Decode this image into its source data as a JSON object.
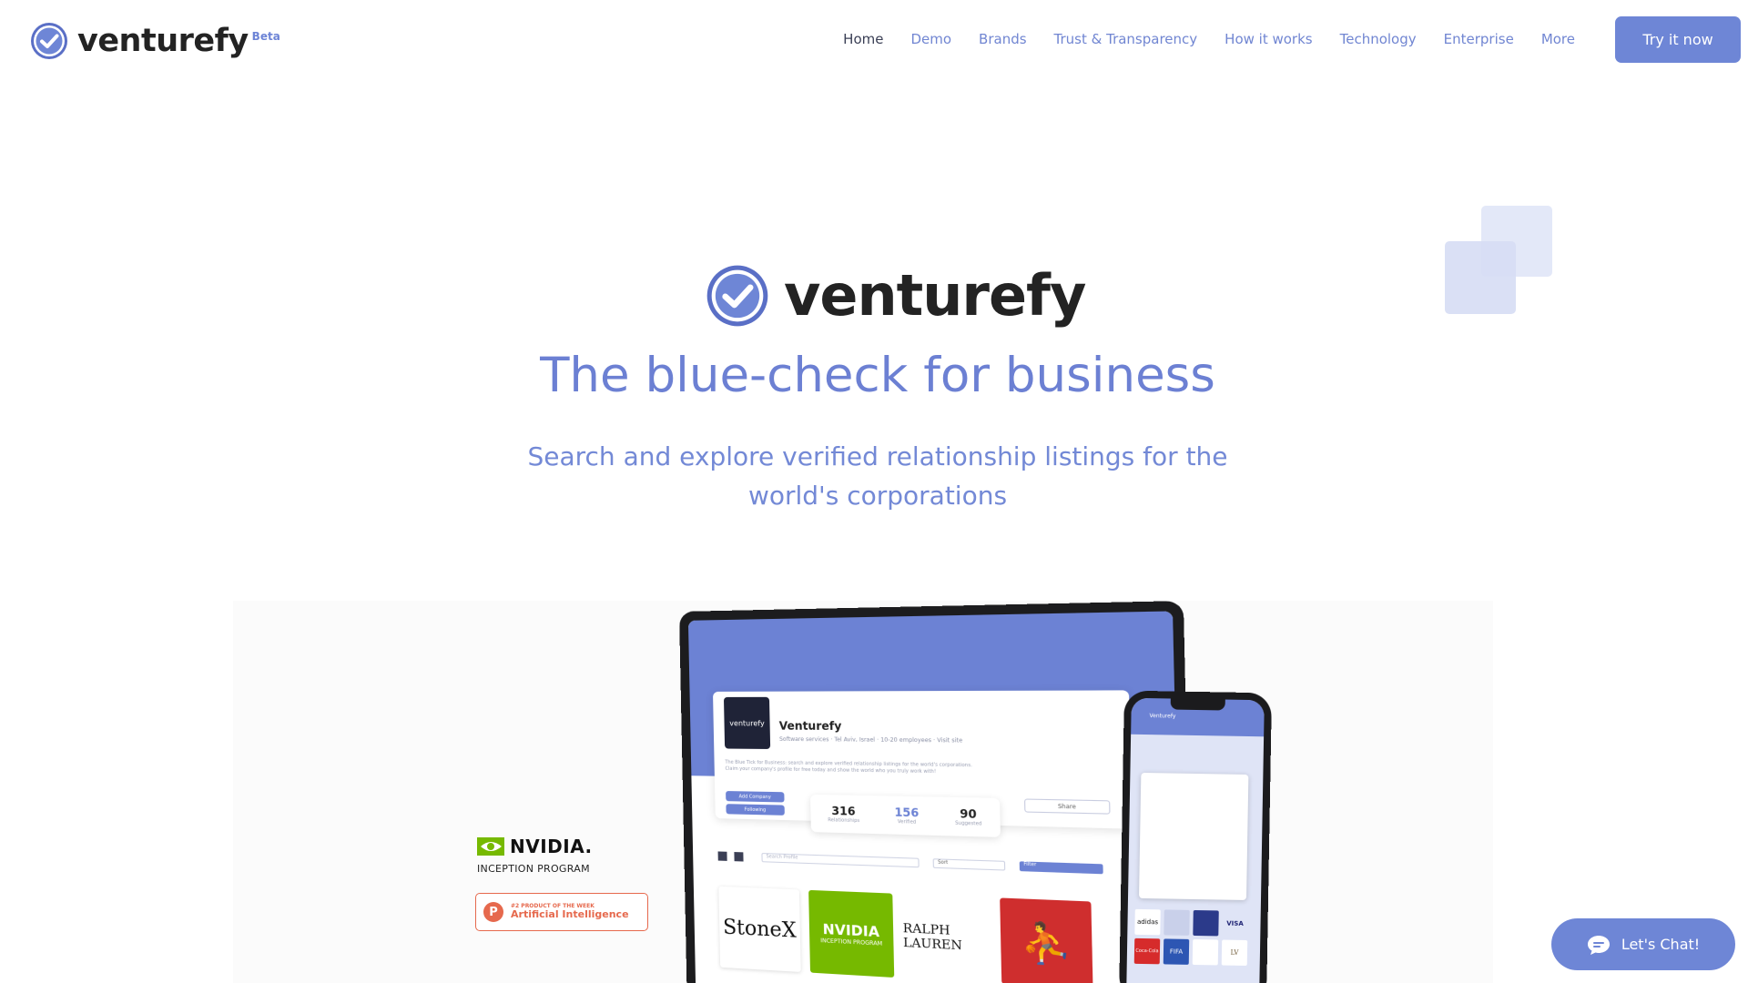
{
  "brand": {
    "name": "venturefy",
    "beta": "Beta",
    "accent": "#6e86d6",
    "dark": "#232323"
  },
  "nav": {
    "items": [
      {
        "label": "Home",
        "active": true
      },
      {
        "label": "Demo"
      },
      {
        "label": "Brands"
      },
      {
        "label": "Trust & Transparency"
      },
      {
        "label": "How it works"
      },
      {
        "label": "Technology"
      },
      {
        "label": "Enterprise"
      },
      {
        "label": "More"
      }
    ],
    "cta": "Try it now"
  },
  "hero": {
    "wordmark": "venturefy",
    "headline": "The blue-check for business",
    "subline": "Search and explore verified relationship listings for the world's corporations"
  },
  "badges": {
    "nvidia": "NVIDIA.",
    "nvidia_sub": "INCEPTION PROGRAM",
    "producthunt_small": "#2 PRODUCT OF THE WEEK",
    "producthunt_big": "Artificial Intelligence",
    "producthunt_icon": "P"
  },
  "laptop": {
    "avatar": "venturefy",
    "company": "Venturefy",
    "meta": "Software services · Tel Aviv, Israel · 10-20 employees · Visit site",
    "desc": "The Blue Tick for Business: search and explore verified relationship listings for the world's corporations. Claim your company's profile for free today and show the world who you truly work with!",
    "add_company": "Add Company",
    "following": "Following",
    "share": "Share",
    "stats": [
      {
        "value": "316",
        "label": "Relationships"
      },
      {
        "value": "156",
        "label": "Verified"
      },
      {
        "value": "90",
        "label": "Suggested"
      }
    ],
    "search_placeholder": "Search Profile",
    "sort": "Sort",
    "filter": "Filter",
    "tiles": {
      "stonex": "StoneX",
      "nvidia": "NVIDIA",
      "nvidia_sub": "INCEPTION PROGRAM",
      "ralph": "RALPH LAUREN",
      "jordan": "⛹"
    }
  },
  "phone": {
    "title": "Venturefy",
    "grid": [
      "adidas",
      "",
      "",
      "VISA",
      "Coca-Cola",
      "FIFA",
      "",
      "LV"
    ]
  },
  "chat": {
    "label": "Let's Chat!"
  }
}
